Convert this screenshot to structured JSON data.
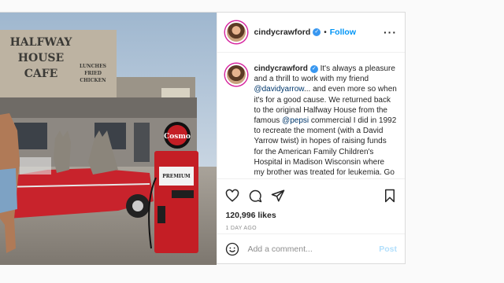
{
  "user": {
    "username": "cindycrawford",
    "follow_label": "Follow",
    "dot": "•"
  },
  "photo": {
    "sign_main": "HALFWAY\nHOUSE\nCAFE",
    "sign_side": "LUNCHES\nFRIED\nCHICKEN",
    "pump_brand": "Cosmo",
    "pump_label": "PREMIUM"
  },
  "caption": {
    "username": "cindycrawford",
    "text_1": " It's always a pleasure and a thrill to work with my friend ",
    "mention_1": "@davidyarrow",
    "text_2": "... and even more so when it's for a good cause. We returned back to the original Halfway House from  the famous ",
    "mention_2": "@pepsi",
    "text_3": " commercial I did in 1992 to recreate the moment (with a David Yarrow twist) in hopes of raising funds for the American Family Children's Hospital in Madison Wisconsin where my brother was treated for leukemia. Go to bid"
  },
  "likes": "120,996 likes",
  "time_ago": "1 DAY AGO",
  "comment": {
    "placeholder": "Add a comment...",
    "post_label": "Post"
  },
  "colors": {
    "accent": "#0095f6",
    "car_red": "#c8232c",
    "pump_red": "#c41e25"
  }
}
